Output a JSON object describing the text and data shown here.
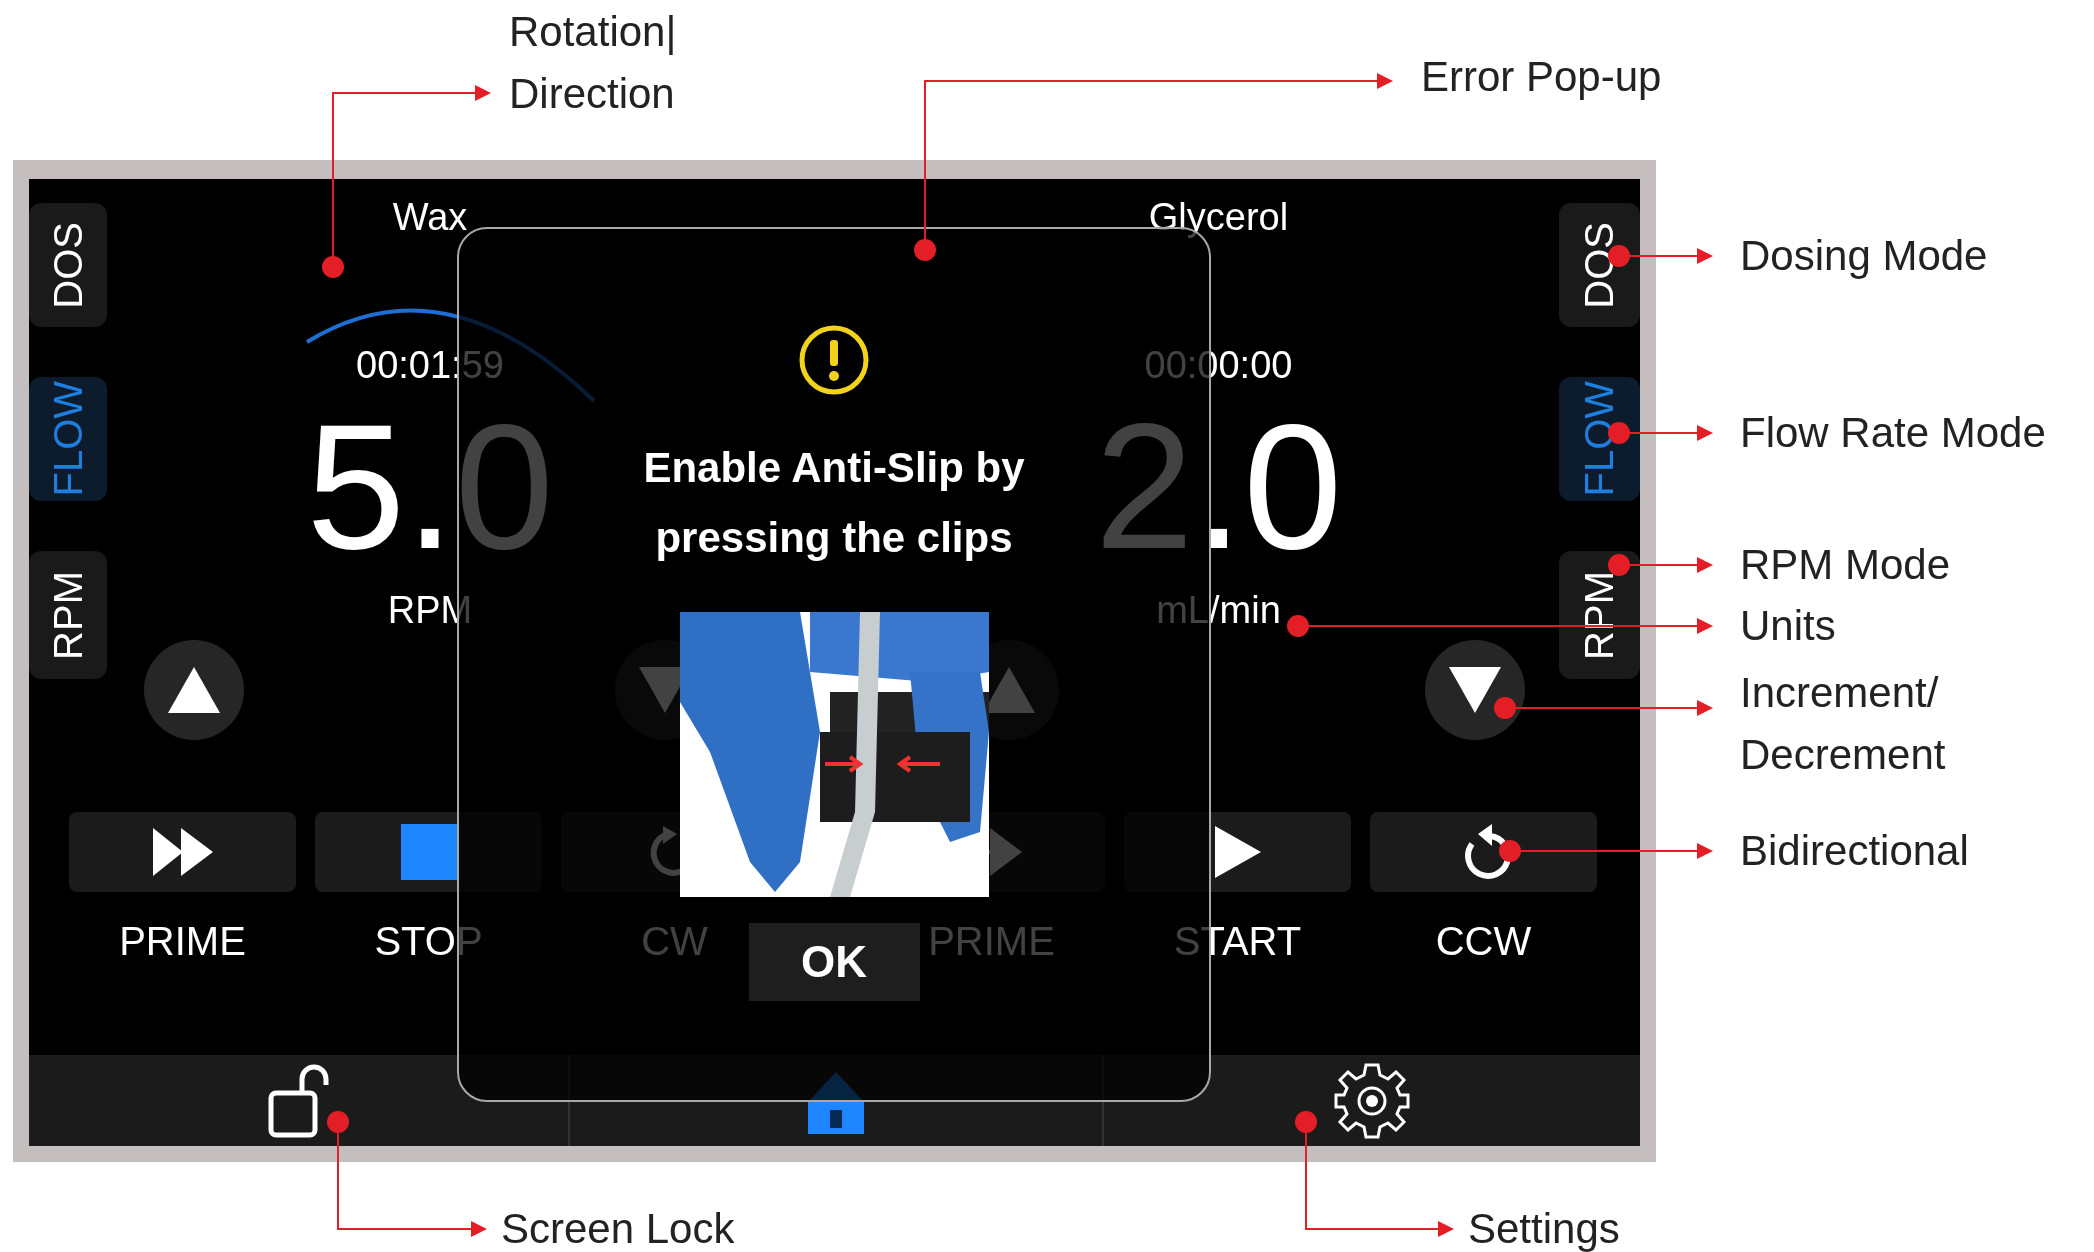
{
  "pumps": [
    {
      "name": "Wax",
      "timer": "00:01:59",
      "value": "5.0",
      "unit": "RPM",
      "rotating": true,
      "modes": [
        {
          "label": "DOS",
          "selected": false
        },
        {
          "label": "FLOW",
          "selected": true
        },
        {
          "label": "RPM",
          "selected": false
        }
      ],
      "controls": [
        {
          "label": "PRIME",
          "kind": "prime"
        },
        {
          "label": "STOP",
          "kind": "stop"
        },
        {
          "label": "CW",
          "kind": "cw"
        }
      ]
    },
    {
      "name": "Glycerol",
      "timer": "00:00:00",
      "value": "2.0",
      "unit": "mL/min",
      "rotating": false,
      "modes": [
        {
          "label": "DOS",
          "selected": false
        },
        {
          "label": "FLOW",
          "selected": true
        },
        {
          "label": "RPM",
          "selected": false
        }
      ],
      "controls": [
        {
          "label": "PRIME",
          "kind": "prime"
        },
        {
          "label": "START",
          "kind": "start"
        },
        {
          "label": "CCW",
          "kind": "ccw"
        }
      ]
    }
  ],
  "popup": {
    "message": "Enable Anti-Slip by pressing the clips",
    "button": "OK"
  },
  "callouts": [
    {
      "lines": [
        "Rotation|",
        "Direction"
      ]
    },
    {
      "lines": [
        "Error Pop-up"
      ]
    },
    {
      "lines": [
        "Dosing Mode"
      ]
    },
    {
      "lines": [
        "Flow Rate Mode"
      ]
    },
    {
      "lines": [
        "RPM Mode"
      ]
    },
    {
      "lines": [
        "Units"
      ]
    },
    {
      "lines": [
        "Increment/",
        "Decrement"
      ]
    },
    {
      "lines": [
        "Bidirectional"
      ]
    },
    {
      "lines": [
        "Screen Lock"
      ]
    },
    {
      "lines": [
        "Settings"
      ]
    }
  ]
}
